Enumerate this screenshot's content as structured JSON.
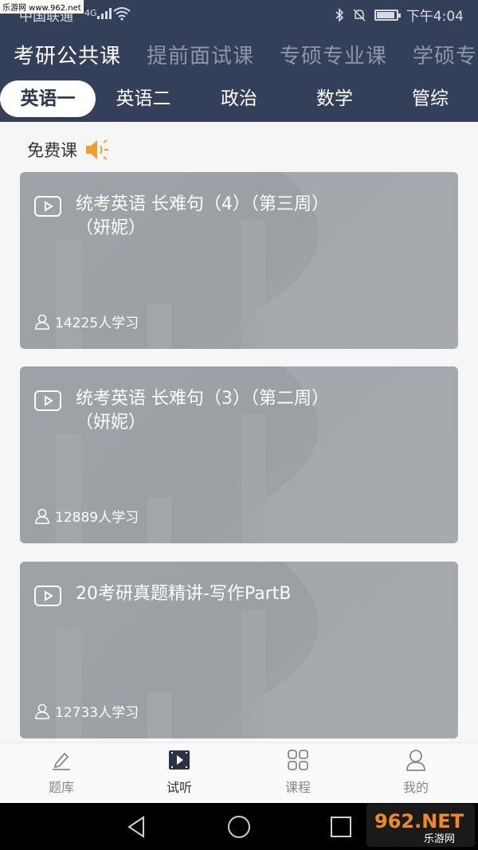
{
  "status": {
    "carrier": "中国联通",
    "signal_type": "4G",
    "time": "下午4:04"
  },
  "categories": [
    {
      "label": "考研公共课",
      "active": true
    },
    {
      "label": "提前面试课",
      "active": false
    },
    {
      "label": "专硕专业课",
      "active": false
    },
    {
      "label": "学硕专",
      "active": false
    }
  ],
  "subjects": [
    {
      "label": "英语一",
      "active": true
    },
    {
      "label": "英语二",
      "active": false
    },
    {
      "label": "政治",
      "active": false
    },
    {
      "label": "数学",
      "active": false
    },
    {
      "label": "管综",
      "active": false
    }
  ],
  "section": {
    "title": "免费课"
  },
  "courses": [
    {
      "title": "统考英语 长难句（4）（第三周）（妍妮）",
      "learners": "14225人学习"
    },
    {
      "title": "统考英语 长难句（3）（第二周）（妍妮）",
      "learners": "12889人学习"
    },
    {
      "title": "20考研真题精讲-写作PartB",
      "learners": "12733人学习"
    }
  ],
  "nav": [
    {
      "label": "题库",
      "icon": "pencil-icon",
      "active": false
    },
    {
      "label": "试听",
      "icon": "play-video-icon",
      "active": true
    },
    {
      "label": "课程",
      "icon": "grid-icon",
      "active": false
    },
    {
      "label": "我的",
      "icon": "profile-icon",
      "active": false
    }
  ],
  "watermark": {
    "top_left": "乐游网 www.962.net",
    "logo": "962.NET",
    "logo_sub": "乐游网"
  },
  "colors": {
    "header_bg": "#34405a",
    "card_bg": "#9ea3a7",
    "accent_speaker": "#f0a030"
  }
}
